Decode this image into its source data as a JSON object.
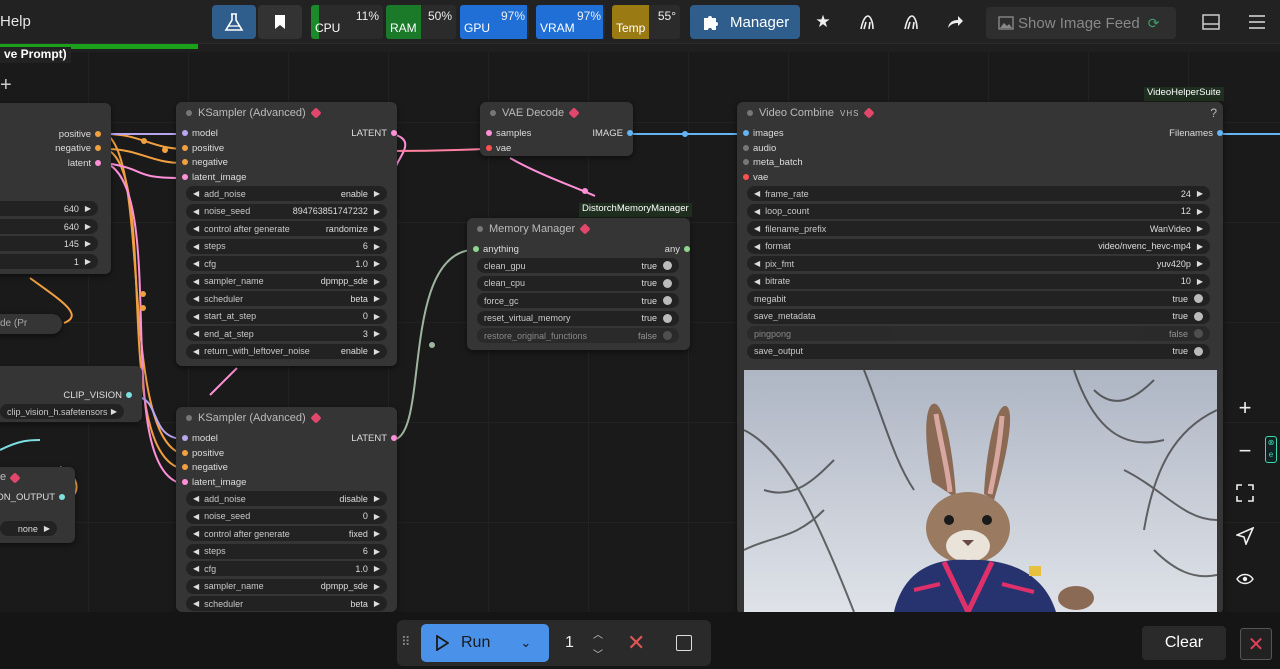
{
  "menu": {
    "help": "Help"
  },
  "monitors": [
    {
      "label": "CPU",
      "percent": "11%",
      "fill": 0.11,
      "color": "#1b8a2a"
    },
    {
      "label": "RAM",
      "percent": "50%",
      "fill": 0.5,
      "color": "#1b7a2a"
    },
    {
      "label": "GPU",
      "percent": "97%",
      "fill": 0.97,
      "color": "#1f6fd6"
    },
    {
      "label": "VRAM",
      "percent": "97%",
      "fill": 0.97,
      "color": "#1f6fd6"
    },
    {
      "label": "Temp",
      "percent": "55°",
      "fill": 0.55,
      "color": "#9a7a12"
    }
  ],
  "manager": "Manager",
  "image_feed": "Show Image Feed",
  "workflow_title": "ve Prompt)",
  "queue_progress": 0.155,
  "accent": "#4a91ea",
  "node_pack_badge": "VideoHelperSuite",
  "distorch_label": "DistorchMemoryManager",
  "left_nodes": {
    "outputs": [
      "positive",
      "negative",
      "latent"
    ],
    "values": [
      "640",
      "640",
      "145",
      "1"
    ],
    "partial_title": "de (Pr",
    "clip_vision_output": "CLIP_VISION",
    "clip_vision_file": "clip_vision_h.safetensors",
    "vision_output": "SION_OUTPUT",
    "none": "none",
    "e": "e"
  },
  "ks1": {
    "title": "KSampler (Advanced)",
    "inputs": [
      "model",
      "positive",
      "negative",
      "latent_image"
    ],
    "output": "LATENT",
    "widgets": [
      {
        "k": "add_noise",
        "v": "enable"
      },
      {
        "k": "noise_seed",
        "v": "894763851747232"
      },
      {
        "k": "control after generate",
        "v": "randomize"
      },
      {
        "k": "steps",
        "v": "6"
      },
      {
        "k": "cfg",
        "v": "1.0"
      },
      {
        "k": "sampler_name",
        "v": "dpmpp_sde"
      },
      {
        "k": "scheduler",
        "v": "beta"
      },
      {
        "k": "start_at_step",
        "v": "0"
      },
      {
        "k": "end_at_step",
        "v": "3"
      },
      {
        "k": "return_with_leftover_noise",
        "v": "enable"
      }
    ]
  },
  "ks2": {
    "title": "KSampler (Advanced)",
    "inputs": [
      "model",
      "positive",
      "negative",
      "latent_image"
    ],
    "output": "LATENT",
    "widgets": [
      {
        "k": "add_noise",
        "v": "disable"
      },
      {
        "k": "noise_seed",
        "v": "0"
      },
      {
        "k": "control after generate",
        "v": "fixed"
      },
      {
        "k": "steps",
        "v": "6"
      },
      {
        "k": "cfg",
        "v": "1.0"
      },
      {
        "k": "sampler_name",
        "v": "dpmpp_sde"
      },
      {
        "k": "scheduler",
        "v": "beta"
      }
    ]
  },
  "vae": {
    "title": "VAE Decode",
    "inputs": [
      "samples",
      "vae"
    ],
    "output": "IMAGE"
  },
  "mem": {
    "title": "Memory Manager",
    "input": "anything",
    "output": "any",
    "widgets": [
      {
        "k": "clean_gpu",
        "v": "true"
      },
      {
        "k": "clean_cpu",
        "v": "true"
      },
      {
        "k": "force_gc",
        "v": "true"
      },
      {
        "k": "reset_virtual_memory",
        "v": "true"
      },
      {
        "k": "restore_original_functions",
        "v": "false"
      }
    ]
  },
  "vc": {
    "title": "Video Combine",
    "badge": "VHS",
    "help": "?",
    "inputs": [
      "images",
      "audio",
      "meta_batch",
      "vae"
    ],
    "output": "Filenames",
    "widgets": [
      {
        "k": "frame_rate",
        "v": "24"
      },
      {
        "k": "loop_count",
        "v": "12"
      },
      {
        "k": "filename_prefix",
        "v": "WanVideo"
      },
      {
        "k": "format",
        "v": "video/nvenc_hevc-mp4"
      },
      {
        "k": "pix_fmt",
        "v": "yuv420p"
      },
      {
        "k": "bitrate",
        "v": "10"
      },
      {
        "k": "megabit",
        "v": "true"
      },
      {
        "k": "save_metadata",
        "v": "true"
      },
      {
        "k": "pingpong",
        "v": "false"
      },
      {
        "k": "save_output",
        "v": "true"
      }
    ]
  },
  "run": {
    "label": "Run",
    "batch": "1"
  },
  "clear": "Clear"
}
